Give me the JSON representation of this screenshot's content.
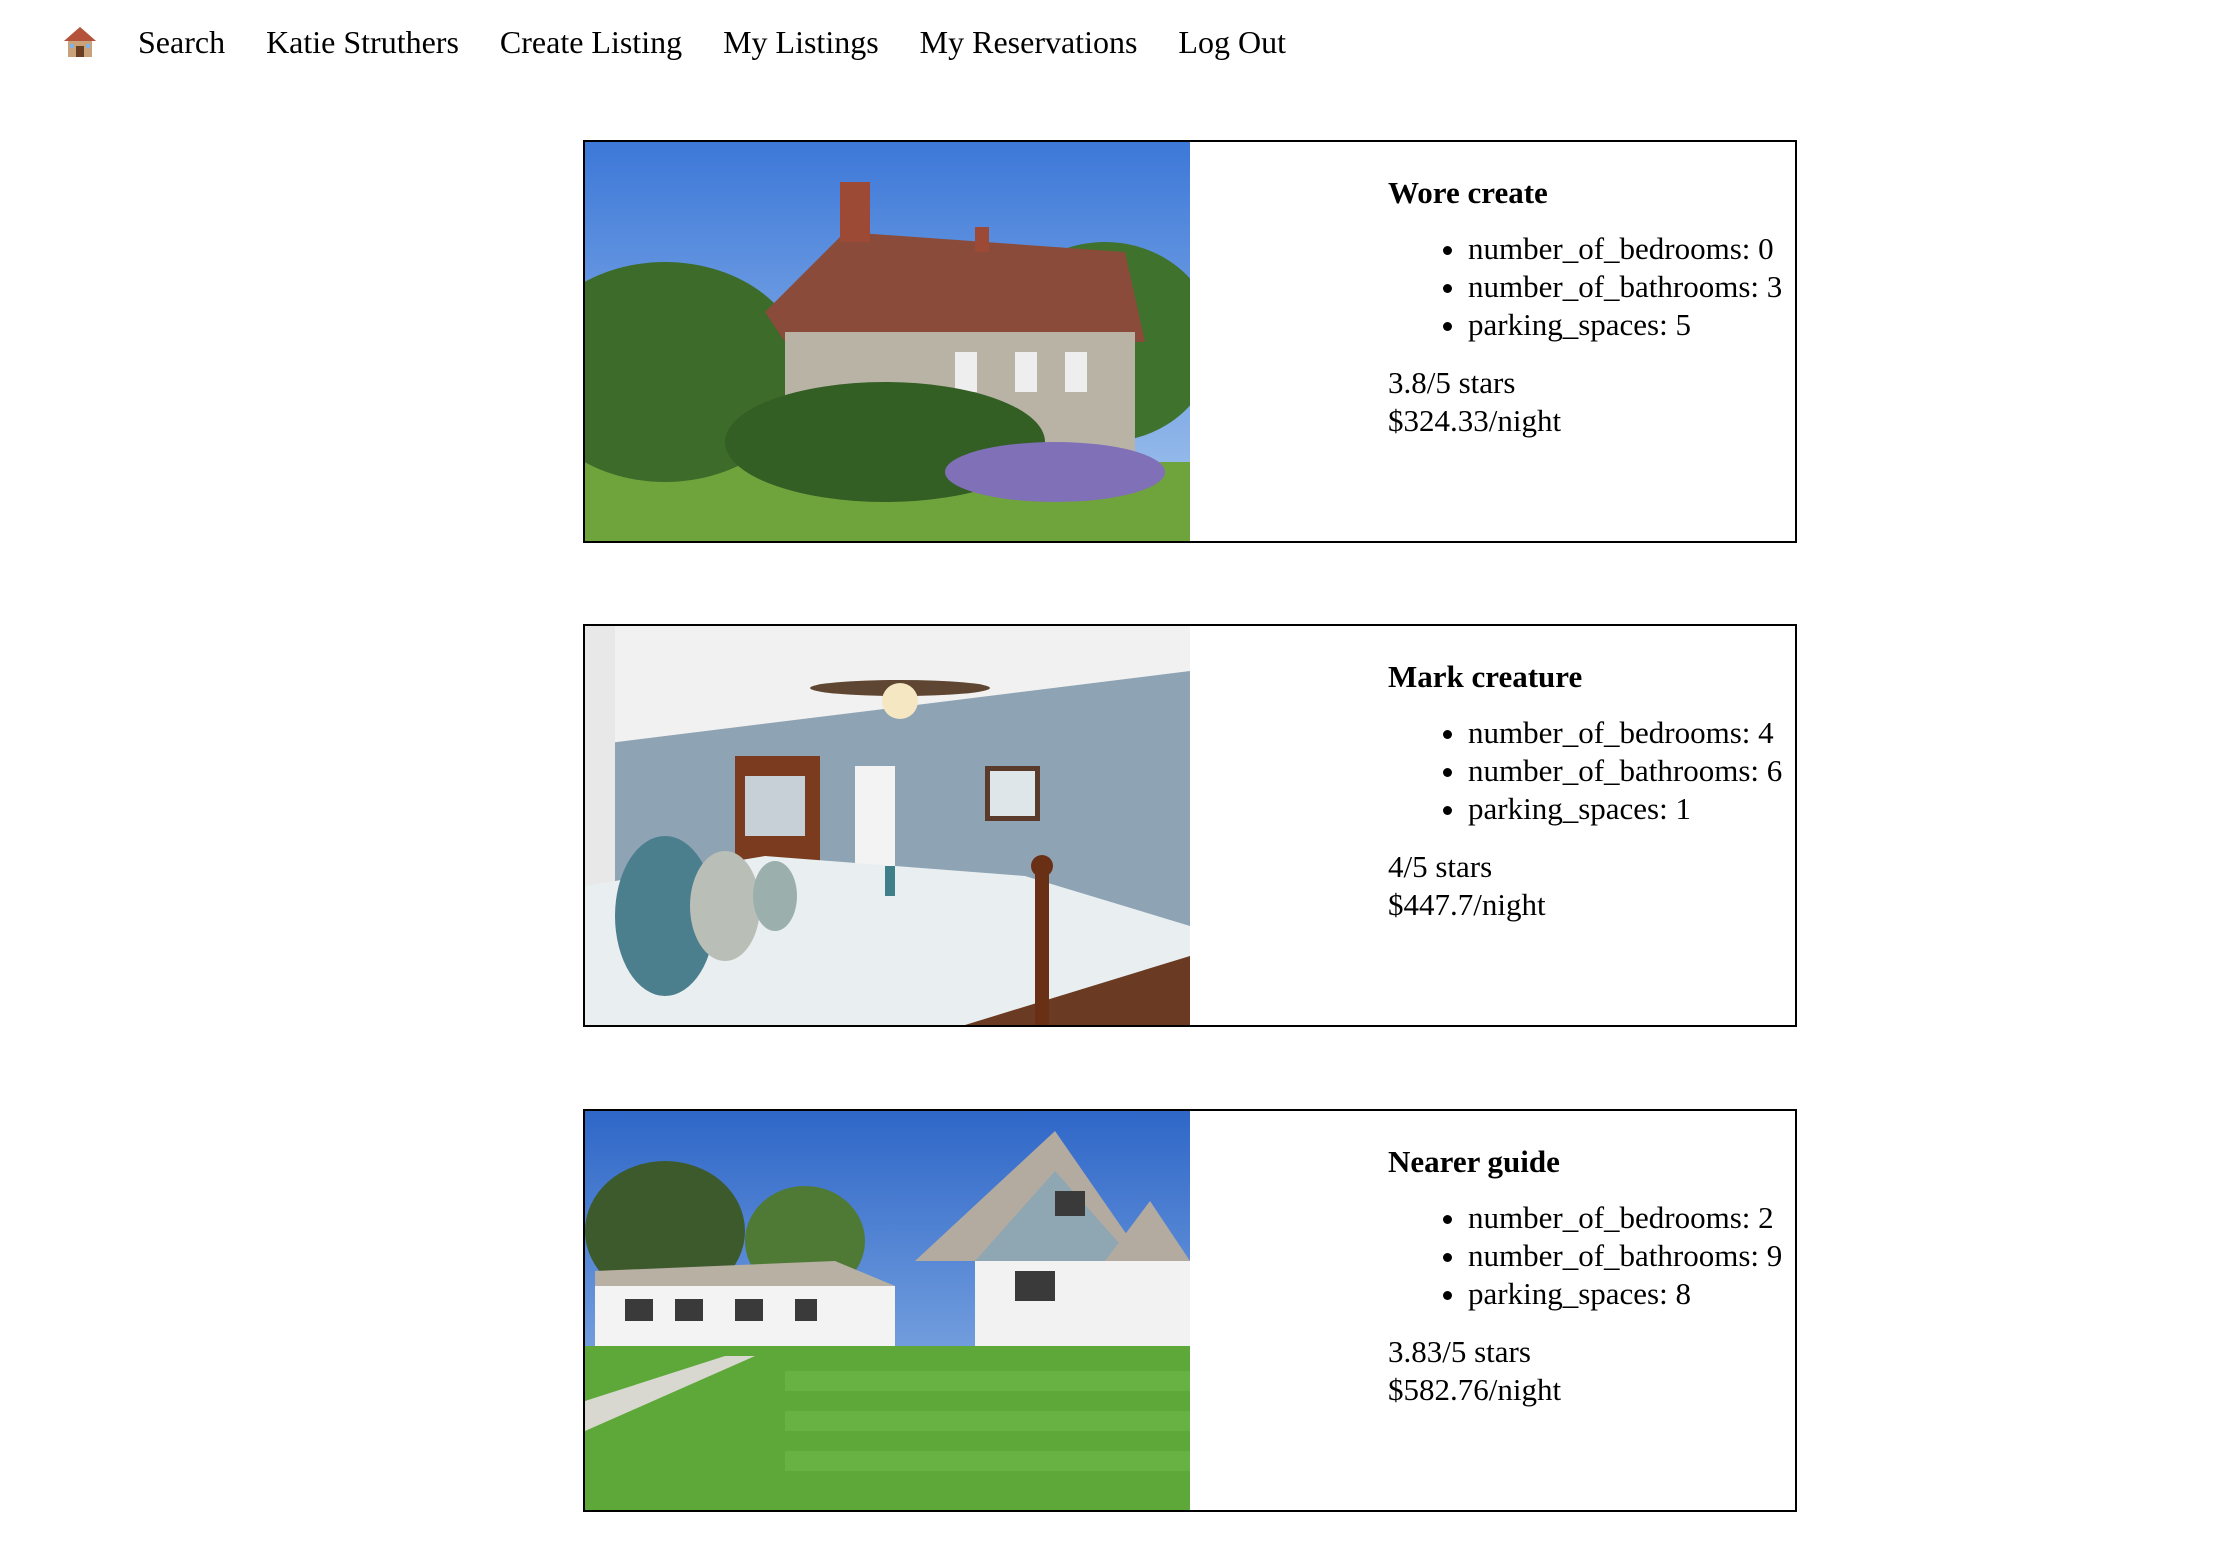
{
  "nav": {
    "home_icon": "house-emoji-icon",
    "links": [
      "Search",
      "Katie Struthers",
      "Create Listing",
      "My Listings",
      "My Reservations",
      "Log Out"
    ]
  },
  "listings": [
    {
      "title": "Wore create",
      "attributes": [
        "number_of_bedrooms: 0",
        "number_of_bathrooms: 3",
        "parking_spaces: 5"
      ],
      "rating": "3.8/5 stars",
      "price": "$324.33/night",
      "photo": "cottage-photo"
    },
    {
      "title": "Mark creature",
      "attributes": [
        "number_of_bedrooms: 4",
        "number_of_bathrooms: 6",
        "parking_spaces: 1"
      ],
      "rating": "4/5 stars",
      "price": "$447.7/night",
      "photo": "bedroom-photo"
    },
    {
      "title": "Nearer guide",
      "attributes": [
        "number_of_bedrooms: 2",
        "number_of_bathrooms: 9",
        "parking_spaces: 8"
      ],
      "rating": "3.83/5 stars",
      "price": "$582.76/night",
      "photo": "modern-house-photo"
    }
  ]
}
